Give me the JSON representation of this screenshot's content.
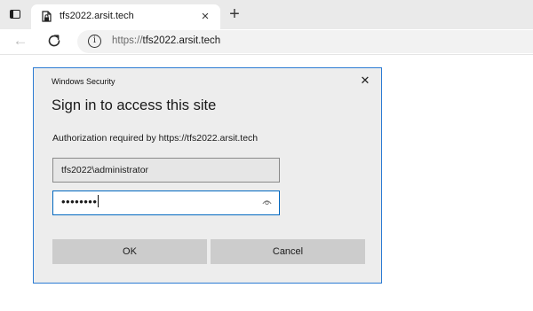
{
  "browser": {
    "tab": {
      "title": "tfs2022.arsit.tech",
      "close_glyph": "×",
      "icon": "page-lock-icon"
    },
    "new_tab_glyph": "+",
    "back_glyph": "←",
    "address": {
      "protocol": "https://",
      "host": "tfs2022.arsit.tech",
      "info_glyph": "i"
    }
  },
  "dialog": {
    "window_title": "Windows Security",
    "close_glyph": "✕",
    "heading": "Sign in to access this site",
    "message": "Authorization required by https://tfs2022.arsit.tech",
    "username_value": "tfs2022\\administrator",
    "password_mask": "••••••••",
    "ok_label": "OK",
    "cancel_label": "Cancel"
  },
  "colors": {
    "dialog_border": "#2b7bd3",
    "focus_border": "#0067c0",
    "button_bg": "#cccccc",
    "dialog_bg": "#ededed"
  }
}
